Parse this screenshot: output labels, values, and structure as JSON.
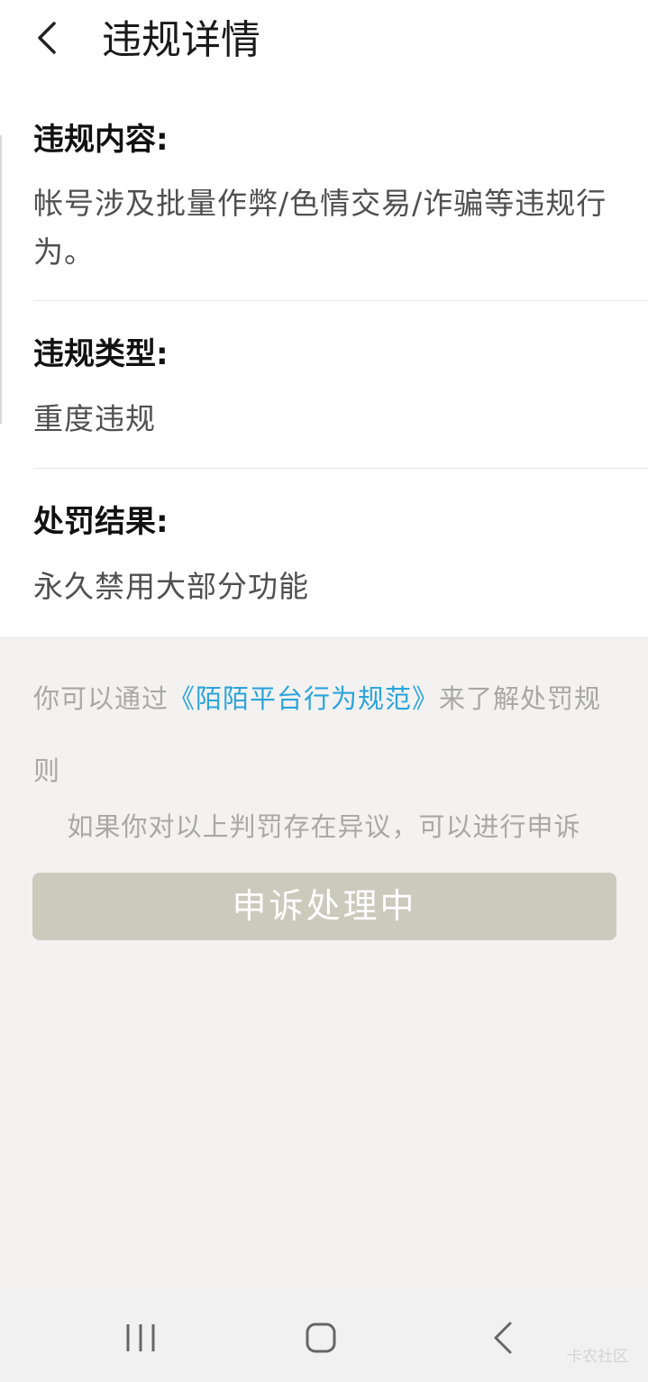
{
  "header": {
    "title": "违规详情",
    "back_icon": "chevron-left-icon"
  },
  "sections": [
    {
      "label": "违规内容:",
      "value": "帐号涉及批量作弊/色情交易/诈骗等违规行为。"
    },
    {
      "label": "违规类型:",
      "value": "重度违规"
    },
    {
      "label": "处罚结果:",
      "value": "永久禁用大部分功能"
    }
  ],
  "rules": {
    "prefix": "你可以通过",
    "link": "《陌陌平台行为规范》",
    "suffix": "来了解处罚规则"
  },
  "appeal": {
    "hint": "如果你对以上判罚存在异议，可以进行申诉",
    "button_label": "申诉处理中"
  },
  "navbar": {
    "icons": [
      "recent-apps-icon",
      "home-icon",
      "back-icon"
    ]
  },
  "watermark": "卡农社区",
  "colors": {
    "link": "#2aa4dc",
    "button_bg": "#ccc9bd",
    "page_bg": "#f3f2f1"
  }
}
